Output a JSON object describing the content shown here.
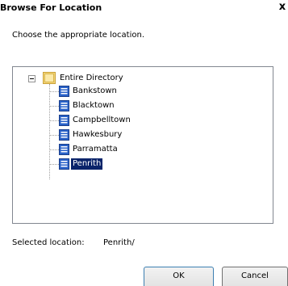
{
  "window": {
    "title": "Browse For Location",
    "close_glyph": "x"
  },
  "instruction": "Choose the appropriate location.",
  "tree": {
    "root": {
      "label": "Entire Directory",
      "expander": "expanded",
      "icon": "directory-folder-icon"
    },
    "children": [
      {
        "label": "Bankstown",
        "icon": "location-node-icon",
        "selected": false
      },
      {
        "label": "Blacktown",
        "icon": "location-node-icon",
        "selected": false
      },
      {
        "label": "Campbelltown",
        "icon": "location-node-icon",
        "selected": false
      },
      {
        "label": "Hawkesbury",
        "icon": "location-node-icon",
        "selected": false
      },
      {
        "label": "Parramatta",
        "icon": "location-node-icon",
        "selected": false
      },
      {
        "label": "Penrith",
        "icon": "location-node-icon",
        "selected": true
      }
    ]
  },
  "selection": {
    "caption": "Selected location:",
    "value": "Penrith/"
  },
  "buttons": {
    "ok_label": "OK",
    "cancel_label": "Cancel"
  },
  "colors": {
    "selection_bg": "#0a246a",
    "selection_fg": "#ffffff",
    "node_icon": "#2a62c8"
  }
}
